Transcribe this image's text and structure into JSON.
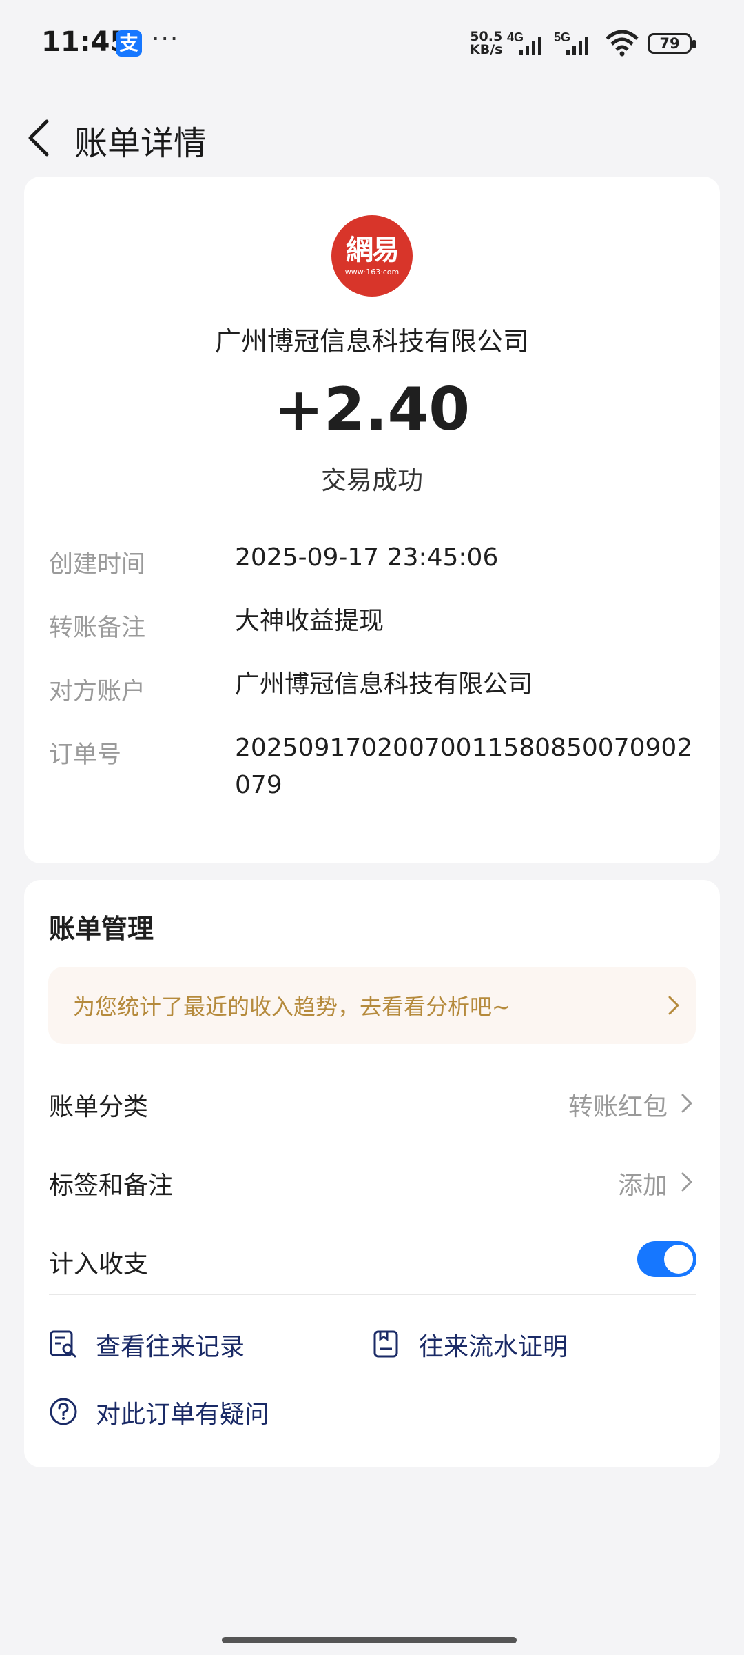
{
  "status_bar": {
    "time": "11:45",
    "app_badge": "支",
    "more": "···",
    "net_speed_value": "50.5",
    "net_speed_unit": "KB/s",
    "sim1": "4G",
    "sim2": "5G",
    "battery": "79"
  },
  "header": {
    "title": "账单详情"
  },
  "bill": {
    "logo_text": "網易",
    "logo_sub": "www·163·com",
    "merchant": "广州博冠信息科技有限公司",
    "amount": "+2.40",
    "status": "交易成功",
    "details": [
      {
        "label": "创建时间",
        "value": "2025-09-17 23:45:06"
      },
      {
        "label": "转账备注",
        "value": "大神收益提现"
      },
      {
        "label": "对方账户",
        "value": "广州博冠信息科技有限公司"
      },
      {
        "label": "订单号",
        "value": "20250917020070011580850070902079"
      }
    ]
  },
  "management": {
    "title": "账单管理",
    "promo": "为您统计了最近的收入趋势，去看看分析吧~",
    "category_label": "账单分类",
    "category_value": "转账红包",
    "tags_label": "标签和备注",
    "tags_value": "添加",
    "include_label": "计入收支",
    "include_on": true,
    "accent_color": "#1677ff",
    "actions": [
      {
        "label": "查看往来记录",
        "icon": "records-search-icon"
      },
      {
        "label": "往来流水证明",
        "icon": "statement-proof-icon"
      },
      {
        "label": "对此订单有疑问",
        "icon": "question-icon"
      }
    ]
  }
}
